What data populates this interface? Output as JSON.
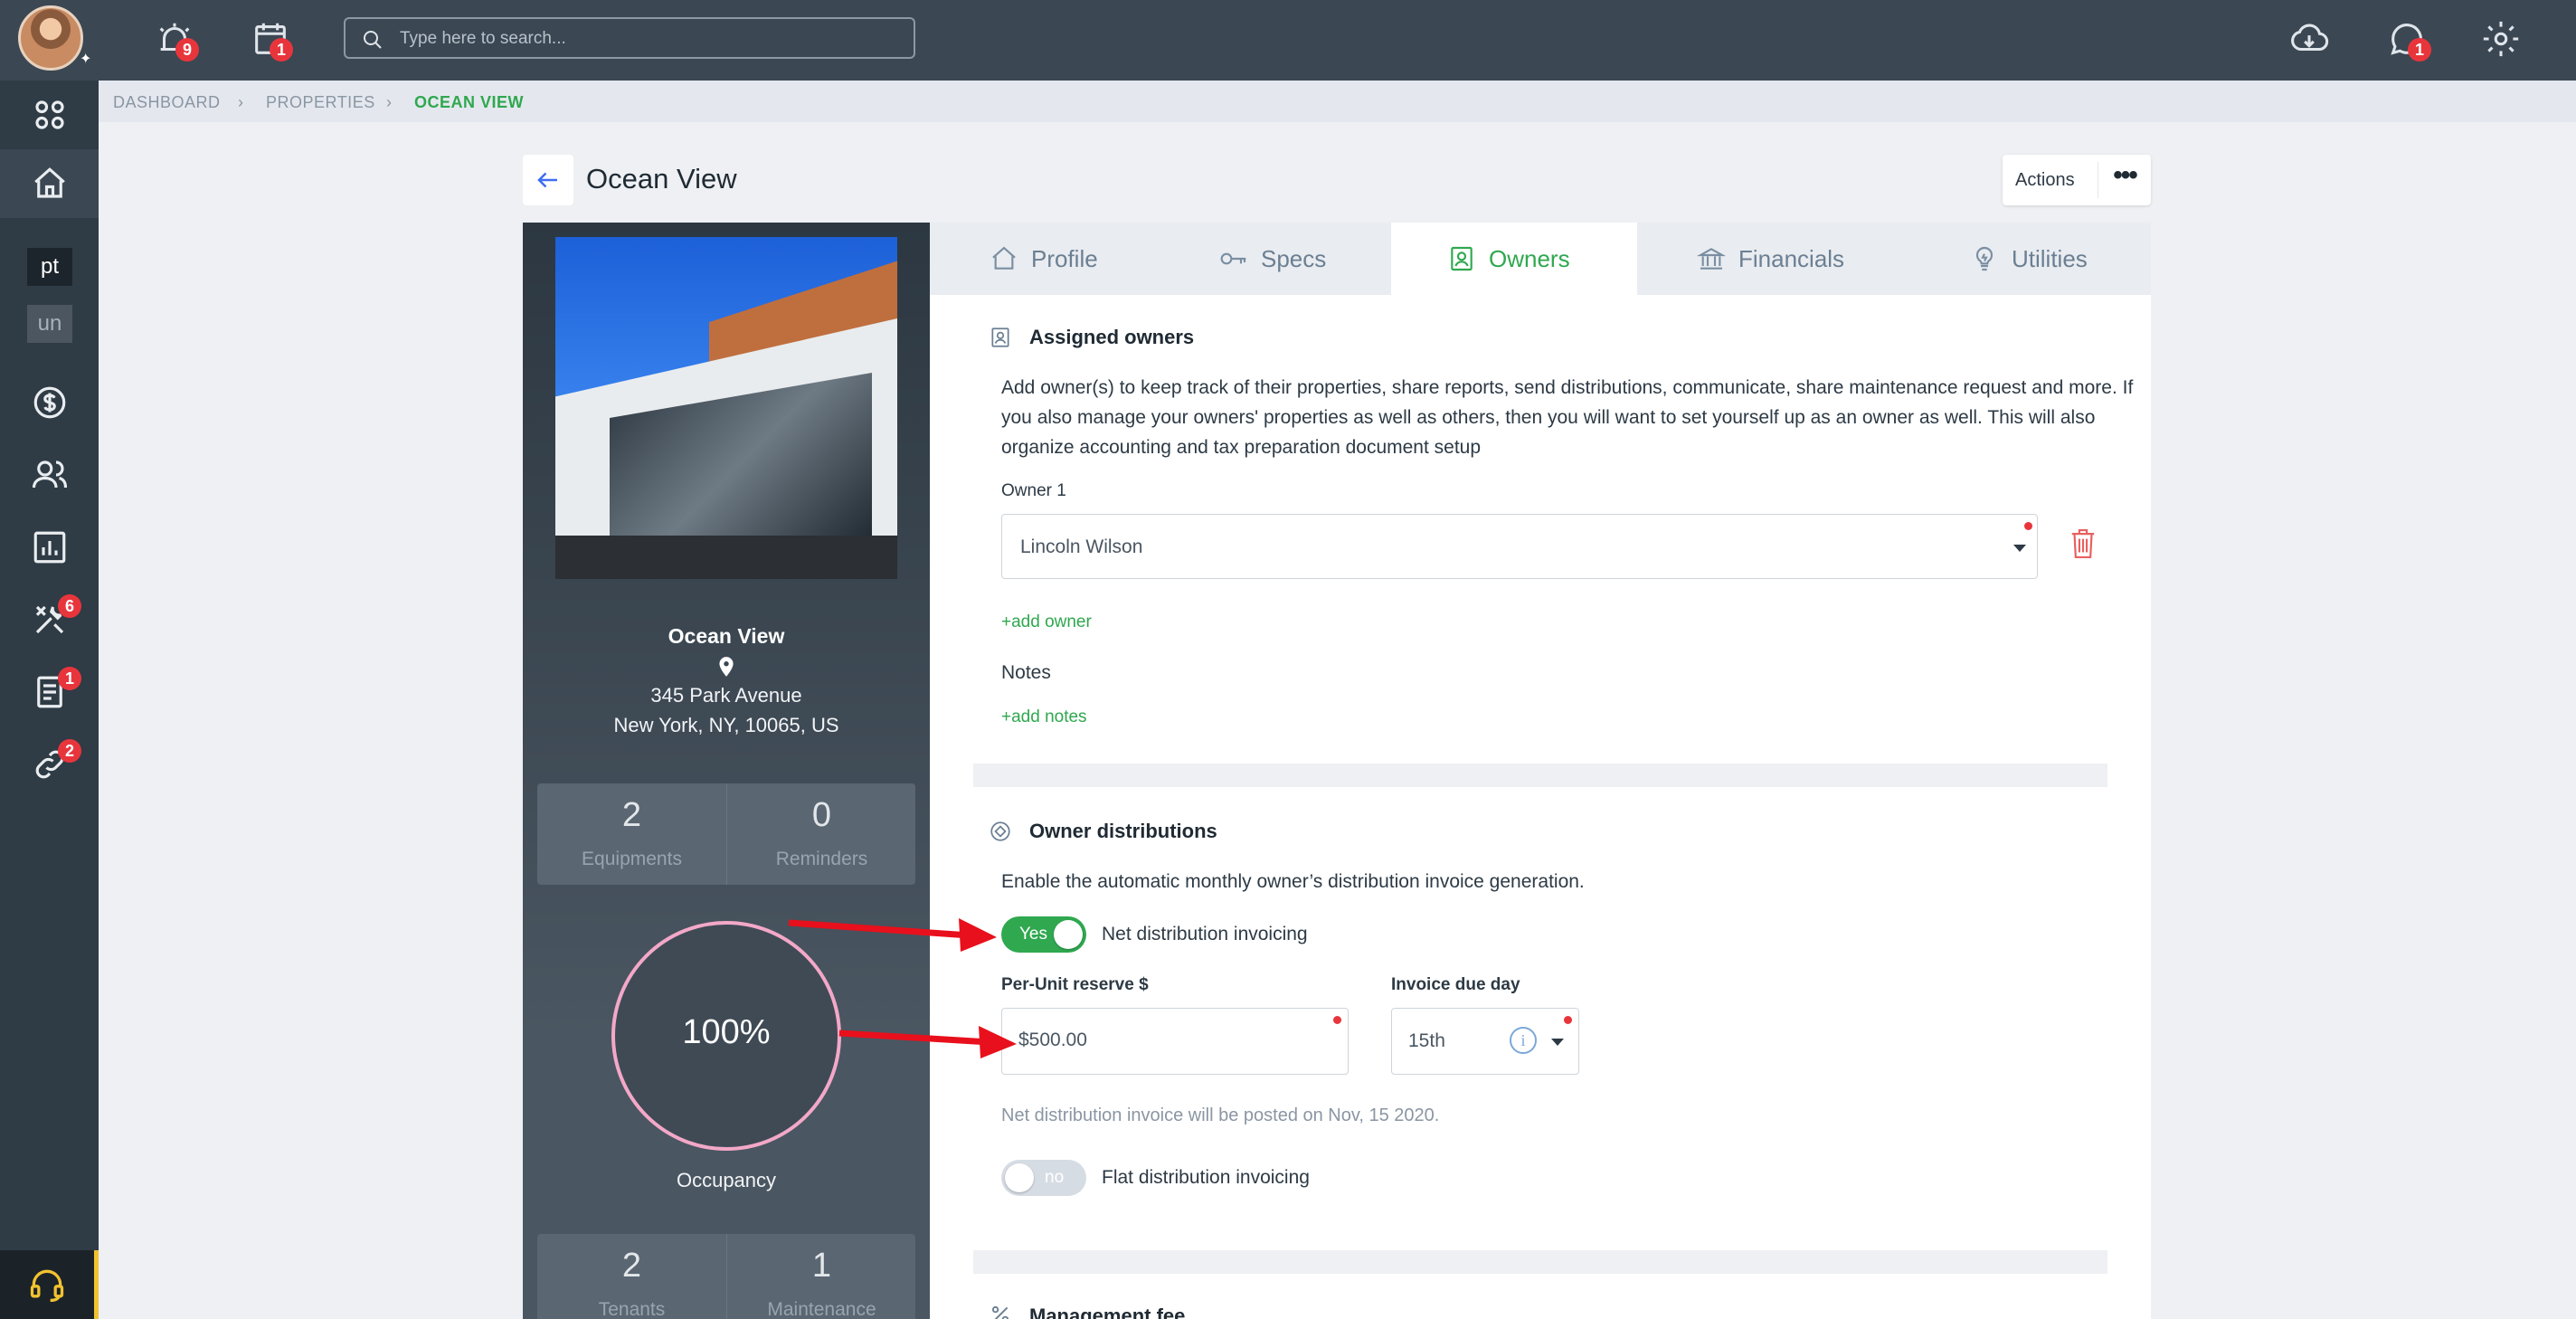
{
  "topbar": {
    "search_placeholder": "Type here to search...",
    "alarm_badge": "9",
    "calendar_badge": "1",
    "chat_badge": "1"
  },
  "sidebar": {
    "pt_label": "pt",
    "un_label": "un",
    "maintenance_badge": "6",
    "documents_badge": "1",
    "links_badge": "2"
  },
  "breadcrumb": {
    "items": [
      "DASHBOARD",
      "PROPERTIES",
      "OCEAN VIEW"
    ]
  },
  "header": {
    "title": "Ocean View",
    "actions_label": "Actions",
    "more_label": "•••"
  },
  "property": {
    "name": "Ocean View",
    "address_line1": "345 Park Avenue",
    "address_line2": "New York, NY, 10065, US",
    "equipments_count": "2",
    "equipments_label": "Equipments",
    "reminders_count": "0",
    "reminders_label": "Reminders",
    "occupancy_pct": "100%",
    "occupancy_label": "Occupancy",
    "tenants_count": "2",
    "tenants_label": "Tenants",
    "maintenance_count": "1",
    "maintenance_label": "Maintenance"
  },
  "tabs": [
    {
      "label": "Profile"
    },
    {
      "label": "Specs"
    },
    {
      "label": "Owners"
    },
    {
      "label": "Financials"
    },
    {
      "label": "Utilities"
    }
  ],
  "owners": {
    "heading": "Assigned owners",
    "description": "Add owner(s) to keep track of their properties, share reports, send distributions, communicate, share maintenance request and more. If you also manage your owners' properties as well as others, then you will want to set yourself up as an owner as well. This will also organize accounting and tax preparation document setup",
    "owner1_label": "Owner 1",
    "owner1_value": "Lincoln Wilson",
    "add_owner": "+add owner",
    "notes_label": "Notes",
    "add_notes": "+add notes"
  },
  "distributions": {
    "heading": "Owner distributions",
    "description": "Enable the automatic monthly owner’s distribution invoice generation.",
    "net_toggle_label": "Yes",
    "net_toggle_state": true,
    "net_label": "Net distribution invoicing",
    "reserve_label": "Per-Unit reserve $",
    "reserve_value": "$500.00",
    "due_day_label": "Invoice due day",
    "due_day_value": "15th",
    "info_glyph": "i",
    "posting_note": "Net distribution invoice will be posted on Nov, 15 2020.",
    "flat_toggle_label": "no",
    "flat_toggle_state": false,
    "flat_label": "Flat distribution invoicing"
  },
  "management": {
    "heading": "Management fee"
  },
  "colors": {
    "accent_green": "#2fa84f",
    "topbar": "#3b4753",
    "sidebar": "#2f3b45",
    "badge_red": "#e8353c",
    "arrow_red": "#e8101c",
    "occupancy_ring": "#f3a8c8"
  }
}
